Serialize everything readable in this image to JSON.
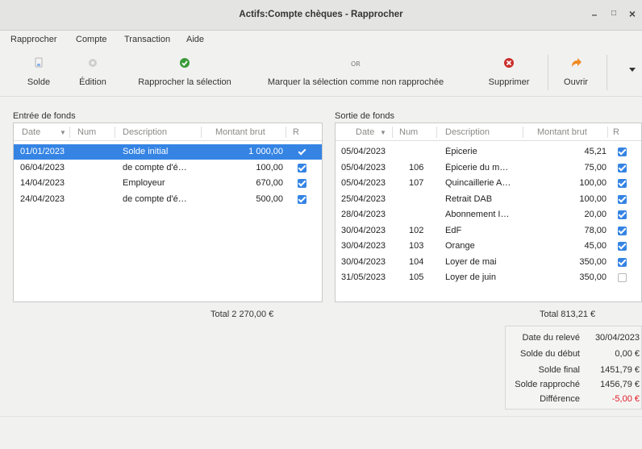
{
  "window": {
    "title": "Actifs:Compte chèques - Rapprocher",
    "min_glyph": "–",
    "max_glyph": "□",
    "close_glyph": "×"
  },
  "menu": [
    "Rapprocher",
    "Compte",
    "Transaction",
    "Aide"
  ],
  "toolbar": {
    "solde": "Solde",
    "edition": "Édition",
    "rapprocher": "Rapprocher la sélection",
    "marquer": "Marquer la sélection comme non rapprochée",
    "supprimer": "Supprimer",
    "ouvrir": "Ouvrir"
  },
  "columns": {
    "date": "Date",
    "num": "Num",
    "description": "Description",
    "montant": "Montant brut",
    "r": "R"
  },
  "entree": {
    "label": "Entrée de fonds",
    "rows": [
      {
        "date": "01/01/2023",
        "num": "",
        "description": "Solde initial",
        "montant": "1 000,00",
        "r": true
      },
      {
        "date": "06/04/2023",
        "num": "",
        "description": "de compte d'é…",
        "montant": "100,00",
        "r": true
      },
      {
        "date": "14/04/2023",
        "num": "",
        "description": "Employeur",
        "montant": "670,00",
        "r": true
      },
      {
        "date": "24/04/2023",
        "num": "",
        "description": "de compte d'é…",
        "montant": "500,00",
        "r": true
      }
    ],
    "total": "Total 2 270,00 €"
  },
  "sortie": {
    "label": "Sortie de fonds",
    "rows": [
      {
        "date": "05/04/2023",
        "num": "",
        "description": "Épicerie",
        "montant": "45,21",
        "r": true
      },
      {
        "date": "05/04/2023",
        "num": "106",
        "description": "Épicerie du m…",
        "montant": "75,00",
        "r": true
      },
      {
        "date": "05/04/2023",
        "num": "107",
        "description": "Quincaillerie A…",
        "montant": "100,00",
        "r": true
      },
      {
        "date": "25/04/2023",
        "num": "",
        "description": "Retrait DAB",
        "montant": "100,00",
        "r": true
      },
      {
        "date": "28/04/2023",
        "num": "",
        "description": "Abonnement I…",
        "montant": "20,00",
        "r": true
      },
      {
        "date": "30/04/2023",
        "num": "102",
        "description": "EdF",
        "montant": "78,00",
        "r": true
      },
      {
        "date": "30/04/2023",
        "num": "103",
        "description": "Orange",
        "montant": "45,00",
        "r": true
      },
      {
        "date": "30/04/2023",
        "num": "104",
        "description": "Loyer de mai",
        "montant": "350,00",
        "r": true
      },
      {
        "date": "31/05/2023",
        "num": "105",
        "description": "Loyer de juin",
        "montant": "350,00",
        "r": false
      }
    ],
    "total": "Total 813,21 €"
  },
  "summary": {
    "date_label": "Date du relevé",
    "date_value": "30/04/2023",
    "debut_label": "Solde du début",
    "debut_value": "0,00 €",
    "final_label": "Solde final",
    "final_value": "1451,79 €",
    "rapproche_label": "Solde rapproché",
    "rapproche_value": "1456,79 €",
    "diff_label": "Différence",
    "diff_value": "-5,00 €"
  },
  "colors": {
    "accent": "#3584e4",
    "negative": "#e01b24"
  }
}
